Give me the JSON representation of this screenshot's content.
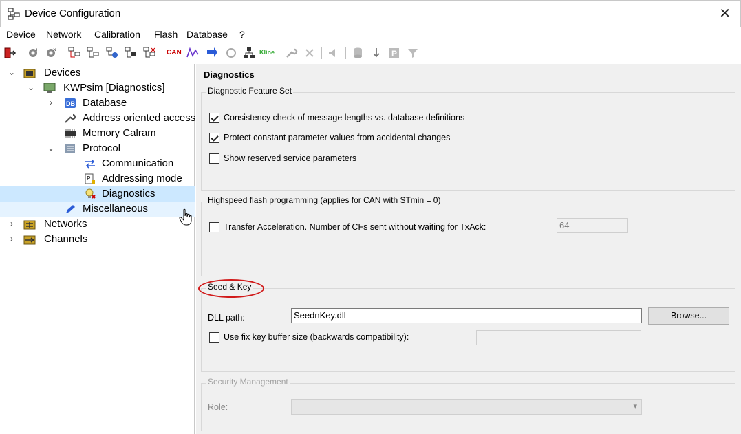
{
  "window": {
    "title": "Device Configuration",
    "close_glyph": "✕"
  },
  "menu": [
    "Device",
    "Network",
    "Calibration",
    "Flash",
    "Database",
    "?"
  ],
  "toolbar": {
    "can_label": "CAN",
    "kline_label": "Kline"
  },
  "tree": {
    "items": [
      {
        "label": "Devices",
        "arrow": "⌄"
      },
      {
        "label": "KWPsim [Diagnostics]",
        "arrow": "⌄"
      },
      {
        "label": "Database",
        "arrow": "›",
        "icon_text": "DB"
      },
      {
        "label": "Address oriented access"
      },
      {
        "label": "Memory Calram"
      },
      {
        "label": "Protocol",
        "arrow": "⌄"
      },
      {
        "label": "Communication"
      },
      {
        "label": "Addressing mode"
      },
      {
        "label": "Diagnostics"
      },
      {
        "label": "Miscellaneous"
      },
      {
        "label": "Networks",
        "arrow": "›"
      },
      {
        "label": "Channels",
        "arrow": "›"
      }
    ]
  },
  "panel": {
    "title": "Diagnostics",
    "feature_set": {
      "title": "Diagnostic Feature Set",
      "options": [
        {
          "label": "Consistency check of message lengths vs. database definitions",
          "checked": true
        },
        {
          "label": "Protect constant parameter values from accidental changes",
          "checked": true
        },
        {
          "label": "Show reserved service parameters",
          "checked": false
        }
      ]
    },
    "highspeed": {
      "title": "Highspeed flash programming (applies for CAN with STmin = 0)",
      "option_label": "Transfer Acceleration. Number of CFs sent without waiting for TxAck:",
      "checked": false,
      "value": "64"
    },
    "seed_key": {
      "title": "Seed & Key",
      "dll_label": "DLL path:",
      "dll_value": "SeednKey.dll",
      "browse_label": "Browse...",
      "fix_key_label": "Use fix key buffer size (backwards compatibility):",
      "fix_key_checked": false,
      "fix_key_value": ""
    },
    "security": {
      "title": "Security Management",
      "role_label": "Role:",
      "role_value": ""
    }
  },
  "colors": {
    "selection": "#cce8ff",
    "hover": "#e5f3ff",
    "highlight_ring": "#d11a1a"
  }
}
